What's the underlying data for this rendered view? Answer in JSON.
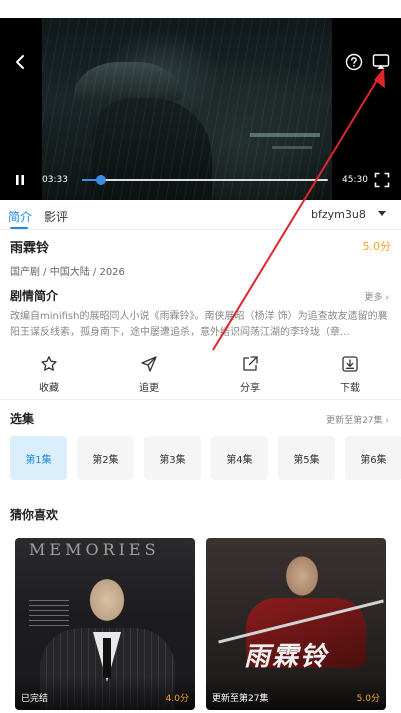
{
  "player": {
    "current_time": "03:33",
    "duration": "45:30",
    "progress_fraction": 0.079,
    "icons": {
      "back": "chevron-left-icon",
      "help": "help-circle-icon",
      "cast": "cast-screen-icon",
      "play_state": "pause-icon",
      "fullscreen": "fullscreen-icon"
    }
  },
  "tabs": {
    "items": [
      {
        "label": "简介"
      },
      {
        "label": "影评"
      }
    ],
    "source": "bfzym3u8"
  },
  "info": {
    "title": "雨霖铃",
    "rating": "5.0分",
    "meta": "国产剧 / 中国大陆 / 2026",
    "synopsis_heading": "剧情简介",
    "synopsis_more": "更多 ›",
    "synopsis_text": "改编自minifish的展昭同人小说《雨霖铃》。南侠展昭（杨洋 饰）为追查故友遗留的襄阳王谋反线索，孤身南下，途中屡遭追杀，意外结识阎荡江湖的李玲珑（章..."
  },
  "actions": [
    {
      "label": "收藏",
      "icon": "star-icon"
    },
    {
      "label": "追更",
      "icon": "send-icon"
    },
    {
      "label": "分享",
      "icon": "share-icon"
    },
    {
      "label": "下载",
      "icon": "download-icon"
    }
  ],
  "episodes": {
    "heading": "选集",
    "update_note": "更新至第27集 ›",
    "items": [
      {
        "label": "第1集"
      },
      {
        "label": "第2集"
      },
      {
        "label": "第3集"
      },
      {
        "label": "第4集"
      },
      {
        "label": "第5集"
      },
      {
        "label": "第6集"
      }
    ],
    "selected_index": 0
  },
  "recommend": {
    "heading": "猜你喜欢",
    "cards": [
      {
        "status": "已完结",
        "score": "4.0分",
        "poster_text": "MEMORIES"
      },
      {
        "status": "更新至第27集",
        "score": "5.0分",
        "poster_text": "雨霖铃"
      }
    ]
  },
  "colors": {
    "accent": "#1a89e8",
    "rating": "#f5a623",
    "annotation": "#e0262b"
  }
}
